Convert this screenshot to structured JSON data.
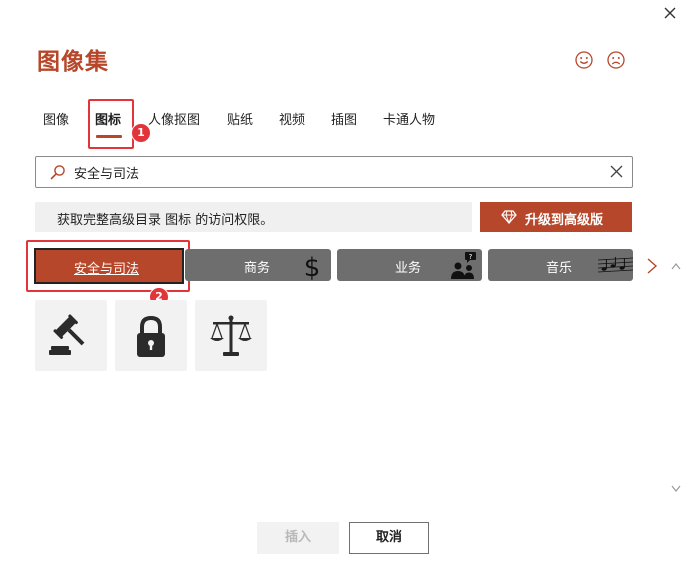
{
  "dialog": {
    "title": "图像集",
    "close_icon": "close-icon",
    "feedback": {
      "smile_icon": "smile-icon",
      "frown_icon": "frown-icon"
    }
  },
  "tabs": [
    {
      "label": "图像",
      "active": false
    },
    {
      "label": "图标",
      "active": true
    },
    {
      "label": "人像抠图",
      "active": false
    },
    {
      "label": "贴纸",
      "active": false
    },
    {
      "label": "视频",
      "active": false
    },
    {
      "label": "插图",
      "active": false
    },
    {
      "label": "卡通人物",
      "active": false
    }
  ],
  "annotations": {
    "badge1": "1",
    "badge2": "2"
  },
  "search": {
    "value": "安全与司法",
    "placeholder": "",
    "icon": "search-icon",
    "clear_icon": "close-icon"
  },
  "upgrade": {
    "message": "获取完整高级目录 图标 的访问权限。",
    "button_label": "升级到高级版",
    "button_icon": "diamond-icon"
  },
  "categories": [
    {
      "label": "安全与司法",
      "active": true
    },
    {
      "label": "商务",
      "active": false,
      "icon": "dollar-icon"
    },
    {
      "label": "业务",
      "active": false,
      "icon": "people-chat-icon"
    },
    {
      "label": "音乐",
      "active": false,
      "icon": "music-staff-icon"
    }
  ],
  "icons": [
    {
      "name": "gavel-icon"
    },
    {
      "name": "lock-icon"
    },
    {
      "name": "scales-icon"
    }
  ],
  "footer": {
    "insert_label": "插入",
    "cancel_label": "取消"
  },
  "colors": {
    "accent": "#b7472a",
    "highlight": "#e2353a",
    "category_bg": "#6e6e6e"
  }
}
